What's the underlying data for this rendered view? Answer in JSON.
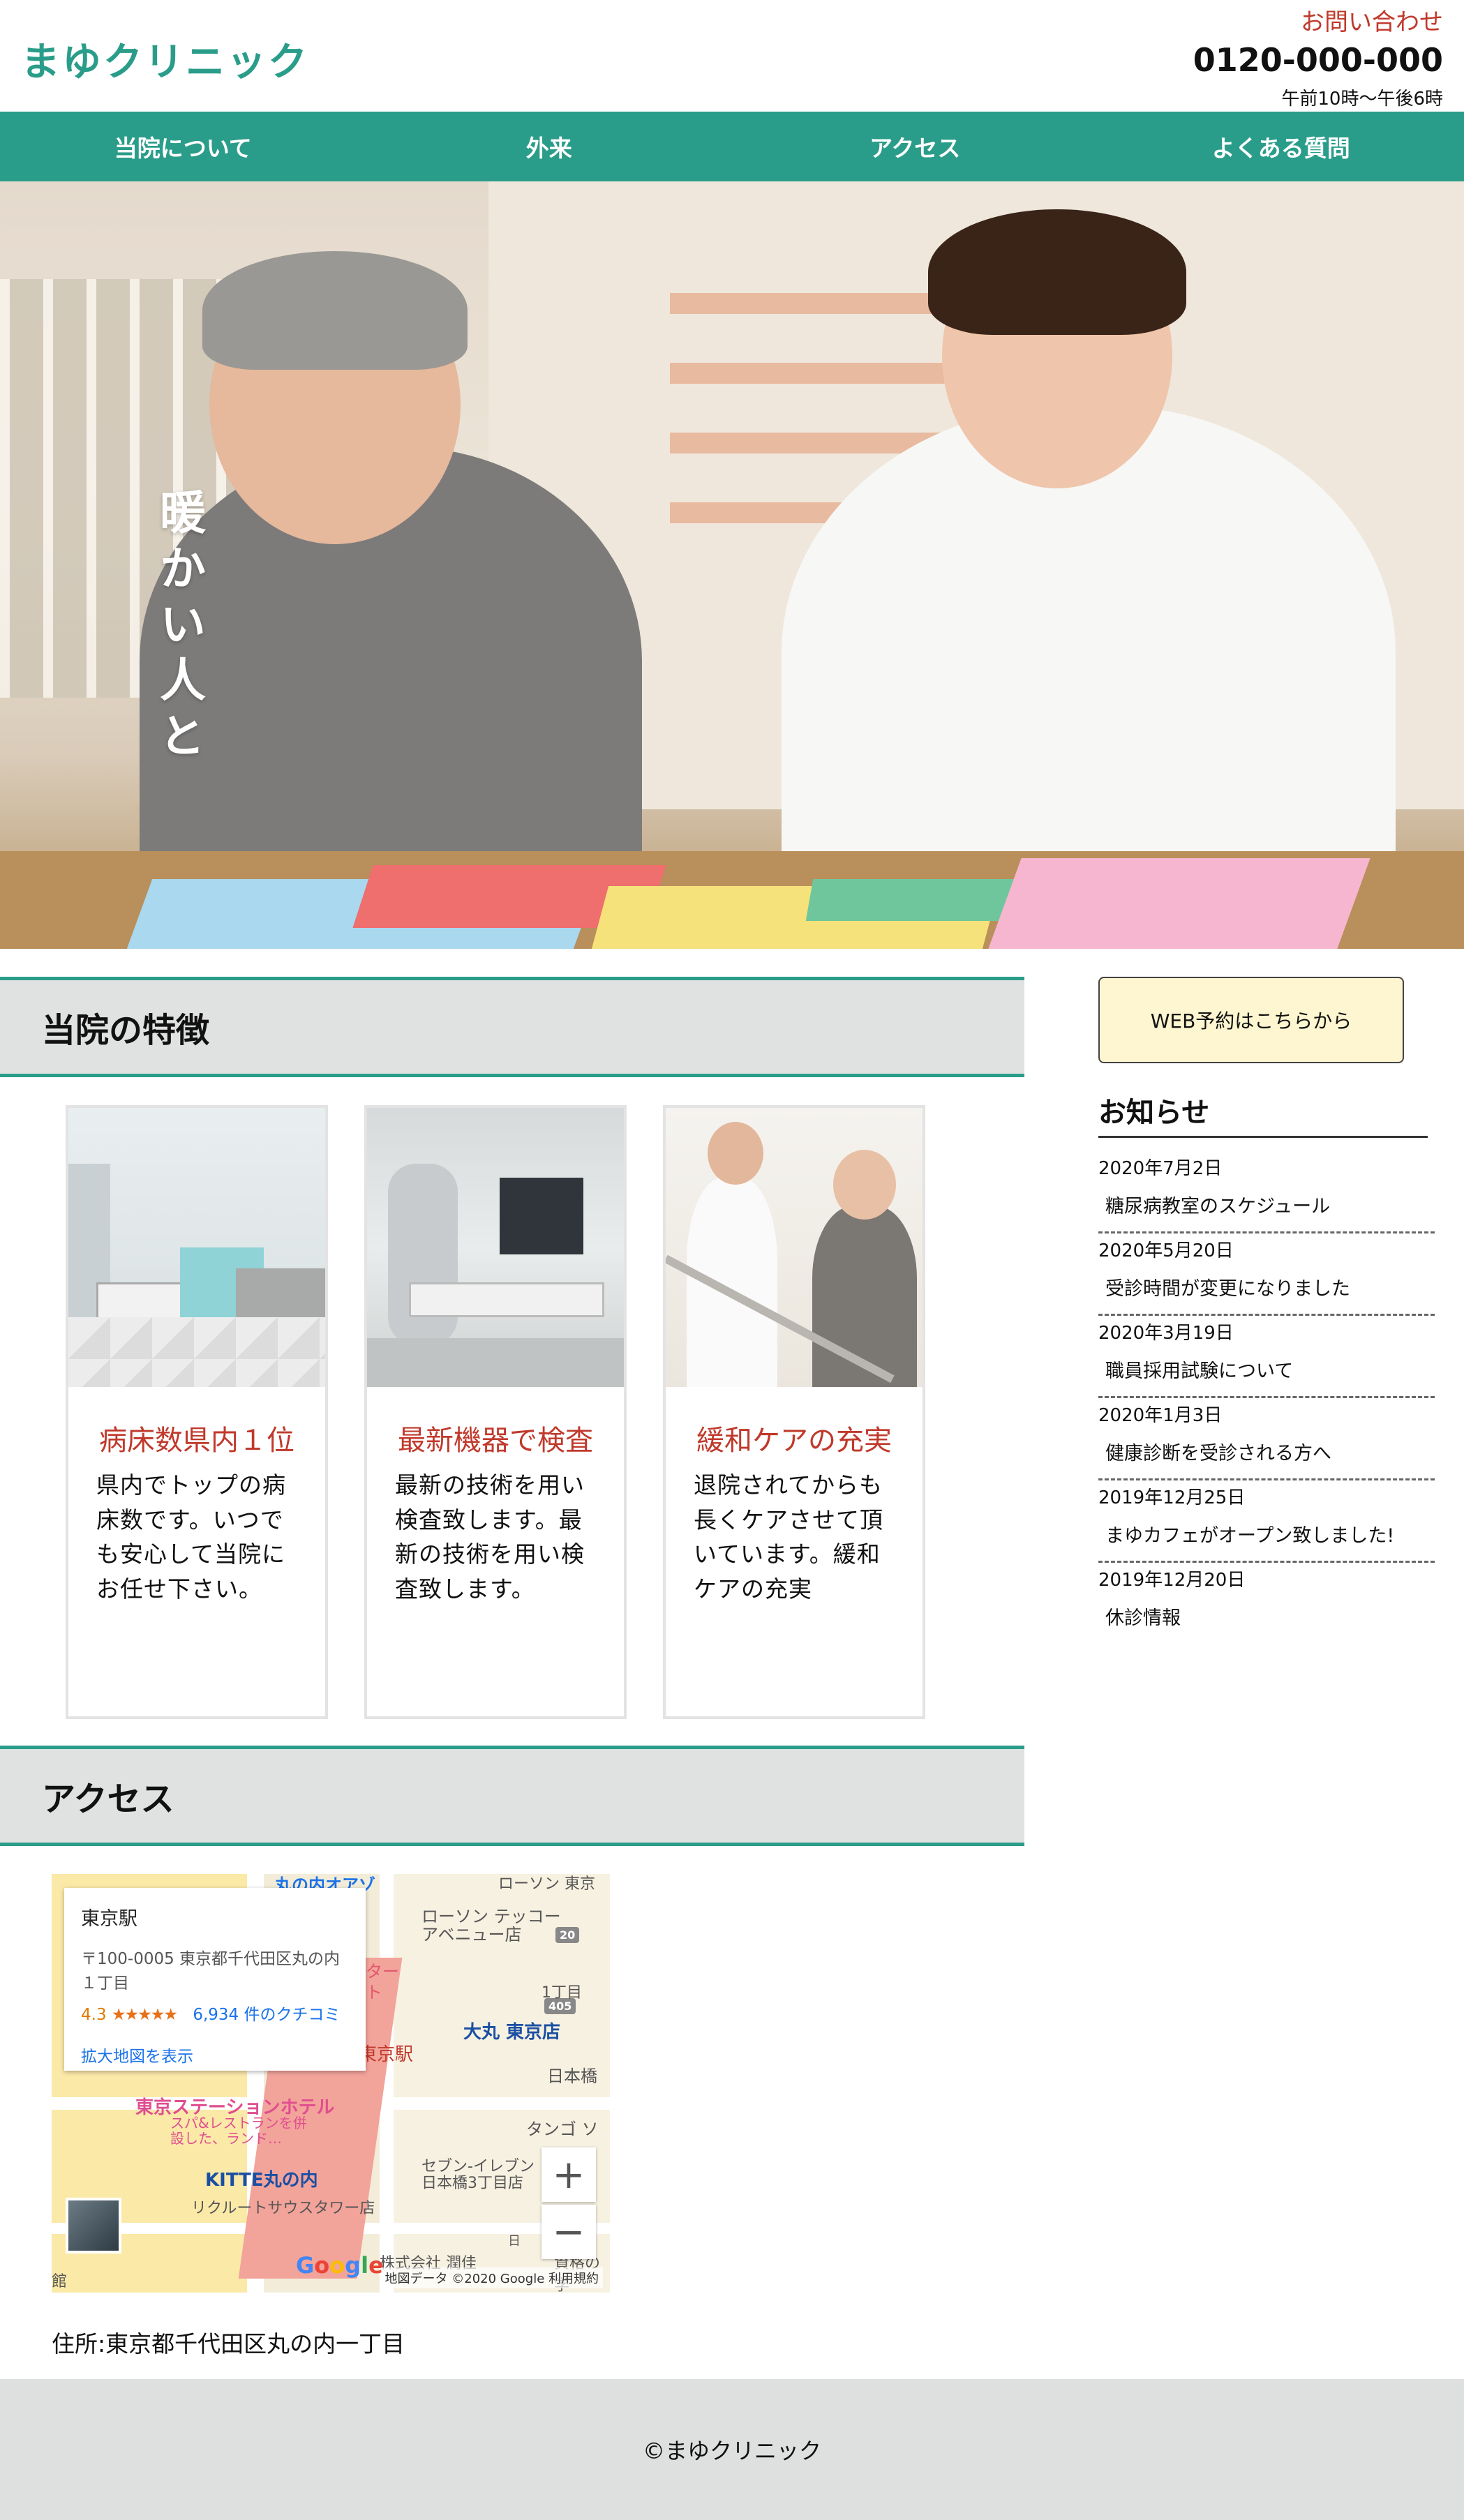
{
  "header": {
    "logo": "まゆクリニック",
    "contact_link": "お問い合わせ",
    "phone": "0120-000-000",
    "hours": "午前10時〜午後6時"
  },
  "nav": {
    "items": [
      "当院について",
      "外来",
      "アクセス",
      "よくある質問"
    ]
  },
  "hero": {
    "tagline": "暖かい人と"
  },
  "features": {
    "title": "当院の特徴",
    "cards": [
      {
        "title": "病床数県内１位",
        "body": "県内でトップの病床数です。いつでも安心して当院にお任せ下さい。"
      },
      {
        "title": "最新機器で検査",
        "body": "最新の技術を用い検査致します。最新の技術を用い検査致します。"
      },
      {
        "title": "緩和ケアの充実",
        "body": "退院されてからも長くケアさせて頂いています。緩和ケアの充実"
      }
    ]
  },
  "sidebar": {
    "web_button": "WEB予約はこちらから",
    "news_title": "お知らせ",
    "news": [
      {
        "date": "2020年7月2日",
        "text": "糖尿病教室のスケジュール"
      },
      {
        "date": "2020年5月20日",
        "text": "受診時間が変更になりました"
      },
      {
        "date": "2020年3月19日",
        "text": "職員採用試験について"
      },
      {
        "date": "2020年1月3日",
        "text": "健康診断を受診される方へ"
      },
      {
        "date": "2019年12月25日",
        "text": "まゆカフェがオープン致しました!"
      },
      {
        "date": "2019年12月20日",
        "text": "休診情報"
      }
    ]
  },
  "access": {
    "title": "アクセス",
    "map": {
      "place_name": "東京駅",
      "address": "〒100-0005 東京都千代田区丸の内１丁目",
      "rating": "4.3",
      "stars": "★★★★★",
      "reviews": "6,934 件のクチコミ",
      "larger_map": "拡大地図を表示",
      "zoom_in": "+",
      "zoom_out": "−",
      "labels": {
        "daimaru": "大丸 東京店",
        "hotel": "東京ステーションホテル",
        "kitte": "KITTE丸の内",
        "lawson": "ローソン テッコー アベニュー店",
        "seven": "セブン-イレブン 日本橋3丁目店",
        "nihonbashi": "日本橋",
        "recruit": "リクルートサウスタワー店",
        "tokyo_station": "東京駅",
        "chome": "1丁目",
        "tango": "タンゴ ソ",
        "marunouchi": "丸の内オアゾ",
        "tokyo_tower_label": "ローソン 東京",
        "route": "405",
        "route2": "20",
        "hotel_sub": "スパ&レストランを併設した、ランド…",
        "kabushiki": "株式会社 潤佳",
        "shiryo": "資格の学",
        "kan": "館",
        "mirai": "ター",
        "to": "ト",
        "nichi": "日"
      },
      "google": "Google",
      "map_footer": "地図データ ©2020 Google  利用規約"
    },
    "address": "住所:東京都千代田区丸の内一丁目"
  },
  "footer": {
    "copyright": "©まゆクリニック"
  },
  "colors": {
    "accent": "#2a9d8a",
    "card_title": "#c0392b",
    "contact": "#c0392b",
    "button_bg": "#fdf6d0",
    "section_bg": "#dfe2e1",
    "footer_bg": "#dde0df"
  }
}
